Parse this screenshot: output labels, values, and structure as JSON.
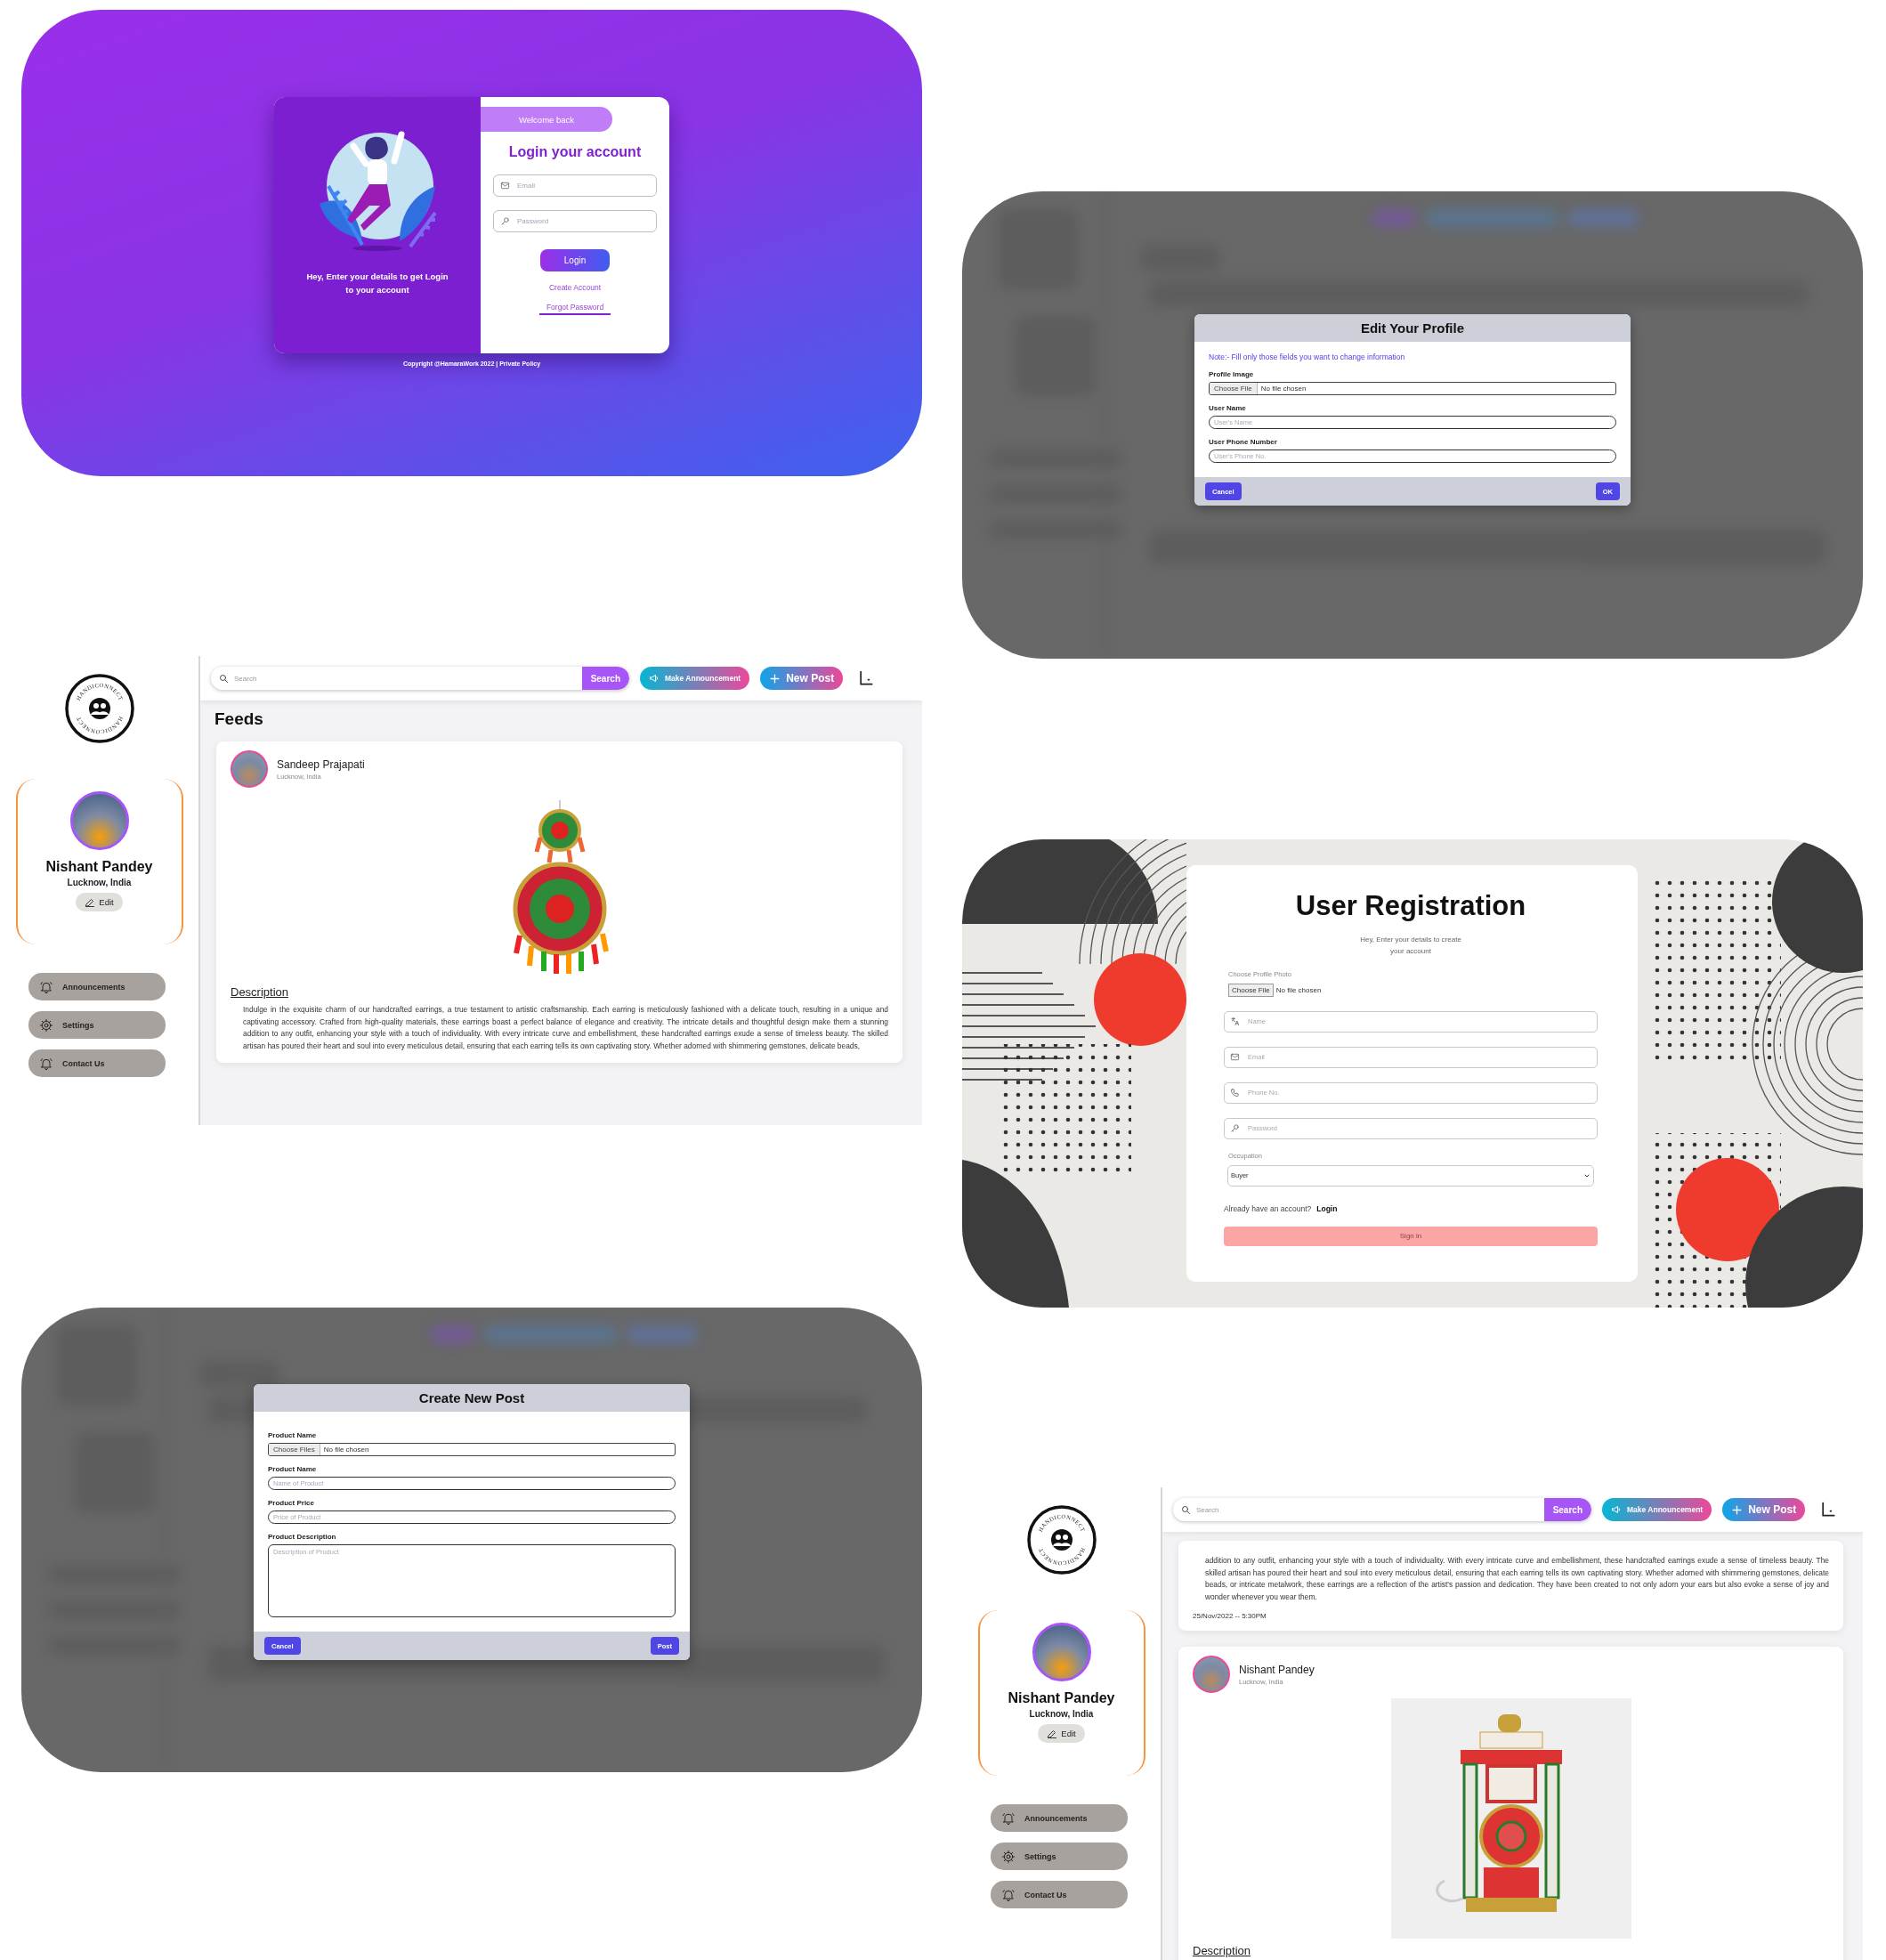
{
  "login_screen": {
    "welcome_tab": "Welcome back",
    "title": "Login your account",
    "fields": [
      {
        "kind": "email",
        "placeholder": "Email"
      },
      {
        "kind": "password",
        "placeholder": "Password"
      }
    ],
    "login_button": "Login",
    "create_account_link": "Create Account",
    "forgot_password_link": "Forgot Password",
    "tagline": "Hey, Enter your details to get Login to your account",
    "footer": "Copyright @HamaraWork 2022 | Private Policy"
  },
  "edit_profile_dialog": {
    "title": "Edit Your Profile",
    "note": "Note:- Fill only those fields you want to change information",
    "fields": [
      {
        "kind": "file",
        "label": "Profile Image",
        "button": "Choose File",
        "status": "No file chosen"
      },
      {
        "kind": "text",
        "label": "User Name",
        "placeholder": "User's Name"
      },
      {
        "kind": "text",
        "label": "User Phone Number",
        "placeholder": "User's Phone No."
      }
    ],
    "cancel_button": "Cancel",
    "confirm_button": "OK"
  },
  "feed_screen": {
    "logo": {
      "arc_texts": [
        "HANDICONNECT",
        "HANDICONNECT"
      ]
    },
    "profile": {
      "name": "Nishant Pandey",
      "location": "Lucknow, India",
      "edit_button": "Edit"
    },
    "nav": [
      {
        "kind": "announcements",
        "label": "Announcements"
      },
      {
        "kind": "settings",
        "label": "Settings"
      },
      {
        "kind": "contact",
        "label": "Contact Us"
      }
    ],
    "search": {
      "placeholder": "Search",
      "button": "Search"
    },
    "announce_button": "Make Announcement",
    "new_post_button": "New Post",
    "heading": "Feeds",
    "posts": [
      {
        "author": "Sandeep Prajapati",
        "location": "Lucknow, India",
        "kind": "earring",
        "description_heading": "Description",
        "description": "Indulge in the exquisite charm of our handcrafted earrings, a true testament to artistic craftsmanship. Each earring is meticulously fashioned with a delicate touch, resulting in a unique and captivating accessory. Crafted from high-quality materials, these earrings boast a perfect balance of elegance and creativity. The intricate details and thoughtful design make them a stunning addition to any outfit, enhancing your style with a touch of individuality. With every intricate curve and embellishment, these handcrafted earrings exude a sense of timeless beauty. The skilled artisan has poured their heart and soul into every meticulous detail, ensuring that each earring tells its own captivating story. Whether adorned with shimmering gemstones, delicate beads,"
      }
    ]
  },
  "registration_screen": {
    "title": "User Registration",
    "subtitle": "Hey, Enter your details to create your account",
    "photo_label": "Choose Profile Photo",
    "file_button": "Choose File",
    "file_status": "No file chosen",
    "fields": [
      {
        "kind": "name",
        "placeholder": "Name"
      },
      {
        "kind": "email",
        "placeholder": "Email"
      },
      {
        "kind": "phone",
        "placeholder": "Phone No."
      },
      {
        "kind": "password",
        "placeholder": "Password"
      }
    ],
    "occupation_label": "Occupation",
    "occupation_value": "Buyer",
    "login_prompt": "Already have an account?",
    "login_link": "Login",
    "sign_in_button": "Sign in"
  },
  "create_post_dialog": {
    "title": "Create New Post",
    "fields": [
      {
        "kind": "file",
        "label": "Product Name",
        "button": "Choose Files",
        "status": "No file chosen"
      },
      {
        "kind": "text",
        "label": "Product Name",
        "placeholder": "Name of Product"
      },
      {
        "kind": "text",
        "label": "Product Price",
        "placeholder": "Price of Product"
      },
      {
        "kind": "textarea",
        "label": "Product Description",
        "placeholder": "Description of Product"
      }
    ],
    "cancel_button": "Cancel",
    "confirm_button": "Post"
  },
  "feed_screen_scrolled": {
    "logo": {
      "arc_texts": [
        "HANDICONNECT",
        "HANDICONNECT"
      ]
    },
    "profile": {
      "name": "Nishant Pandey",
      "location": "Lucknow, India",
      "edit_button": "Edit"
    },
    "nav": [
      {
        "kind": "announcements",
        "label": "Announcements"
      },
      {
        "kind": "settings",
        "label": "Settings"
      },
      {
        "kind": "contact",
        "label": "Contact Us"
      }
    ],
    "search": {
      "placeholder": "Search",
      "button": "Search"
    },
    "announce_button": "Make Announcement",
    "new_post_button": "New Post",
    "posts": [
      {
        "description": "addition to any outfit, enhancing your style with a touch of individuality. With every intricate curve and embellishment, these handcrafted earrings exude a sense of timeless beauty. The skilled artisan has poured their heart and soul into every meticulous detail, ensuring that each earring tells its own captivating story. Whether adorned with shimmering gemstones, delicate beads, or intricate metalwork, these earrings are a reflection of the artist's passion and dedication. They have been created to not only adorn your ears but also evoke a sense of joy and wonder whenever you wear them.",
        "date": "25/Nov/2022 -- 5:30PM"
      },
      {
        "author": "Nishant Pandey",
        "location": "Lucknow, India",
        "kind": "lamp",
        "description_heading": "Description"
      }
    ]
  }
}
